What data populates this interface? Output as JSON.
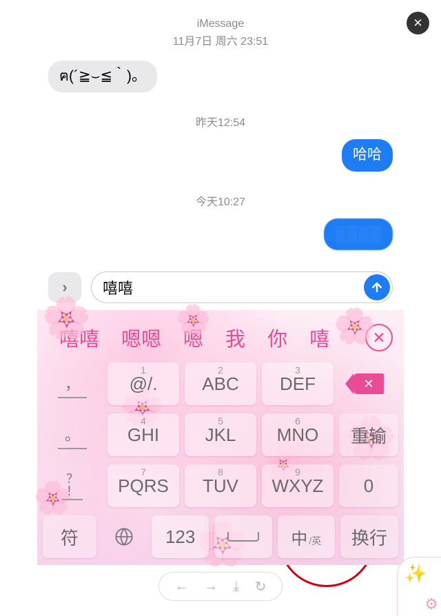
{
  "header": {
    "title": "iMessage",
    "line2": "11月7日 周六 23:51"
  },
  "messages": {
    "recv1": "ฅ(´≧⌣≦｀)。",
    "ts1": "昨天12:54",
    "sent1": "哈哈",
    "ts2": "今天10:27",
    "sent2": "░░░░"
  },
  "compose": {
    "value": "嘻嘻",
    "expand": "›"
  },
  "candidates": [
    "嘻嘻",
    "嗯嗯",
    "嗯",
    "我",
    "你",
    "嘻"
  ],
  "keys": {
    "r1_side": "，",
    "r1_1": "@/.",
    "r1_2": "ABC",
    "r1_3": "DEF",
    "r2_side": "。",
    "r2_1": "GHI",
    "r2_2": "JKL",
    "r2_3": "MNO",
    "r2_act": "重输",
    "r3_side": "？\n！",
    "r3_1": "PQRS",
    "r3_2": "TUV",
    "r3_3": "WXYZ",
    "r3_act": "0",
    "r4_a": "符",
    "r4_c": "123",
    "r4_e_main": "中",
    "r4_e_sub": "/英",
    "r4_f": "换行"
  },
  "viewer": {
    "back": "←",
    "fwd": "→",
    "dl": "⤓",
    "refresh": "↻"
  }
}
